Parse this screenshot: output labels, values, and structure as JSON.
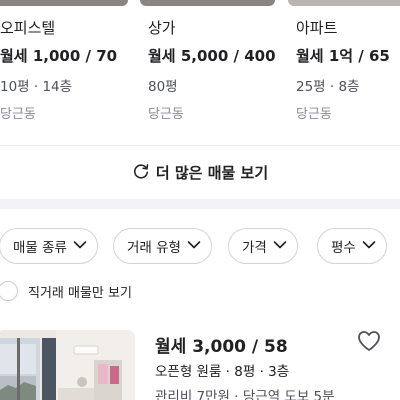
{
  "recommended": {
    "cards": [
      {
        "type": "오피스텔",
        "price": "월세 1,000 / 70",
        "spec": "10평 · 14층",
        "location": "당근동"
      },
      {
        "type": "상가",
        "price": "월세 5,000 / 400",
        "spec": "80평",
        "location": "당근동"
      },
      {
        "type": "아파트",
        "price": "월세 1억 / 65",
        "spec": "25평 · 8층",
        "location": "당근동"
      }
    ],
    "more_label": "더 많은 매물 보기"
  },
  "filters": {
    "chips": [
      {
        "label": "매물 종류",
        "icon": "chevron-down-icon"
      },
      {
        "label": "거래 유형",
        "icon": "chevron-down-icon"
      },
      {
        "label": "가격",
        "icon": "chevron-down-icon"
      },
      {
        "label": "평수",
        "icon": "chevron-down-icon"
      }
    ],
    "direct_only_label": "직거래 매물만 보기",
    "direct_only_checked": false
  },
  "listing": {
    "price": "월세 3,000 / 58",
    "description": "오픈형 원룸 · 8평 · 3층",
    "meta": "관리비 7만원 · 당근역 도보 5분",
    "liked": false
  },
  "colors": {
    "text_primary": "#212124",
    "text_secondary": "#4d5159",
    "text_tertiary": "#868b94",
    "border": "#d1d3d8",
    "section_gap": "#f2f3f6"
  }
}
